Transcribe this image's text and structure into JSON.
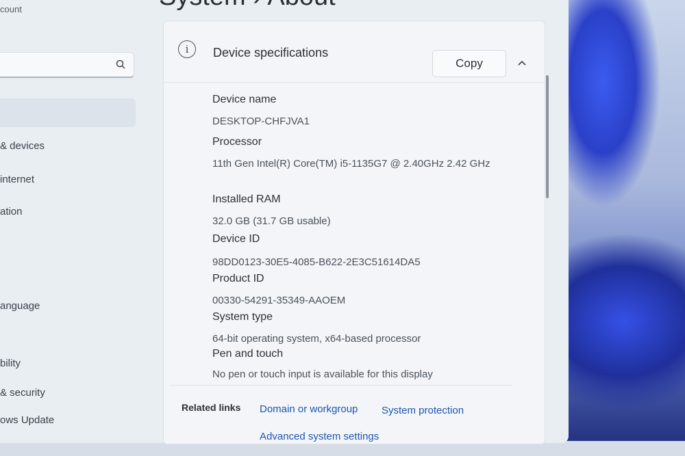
{
  "page": {
    "title": "System  ›  About"
  },
  "sidebar": {
    "account_text": "count",
    "search": {
      "placeholder": "",
      "icon": "search-icon"
    },
    "items": [
      {
        "label": "& devices"
      },
      {
        "label": "internet"
      },
      {
        "label": "ation"
      },
      {
        "label": "anguage"
      },
      {
        "label": "bility"
      },
      {
        "label": "& security"
      },
      {
        "label": "ows Update"
      }
    ]
  },
  "device_specs": {
    "title": "Device specifications",
    "icon": "info-icon",
    "copy_label": "Copy",
    "collapse_icon": "chevron-up-icon",
    "specs": [
      {
        "label": "Device name",
        "value": "DESKTOP-CHFJVA1"
      },
      {
        "label": "Processor",
        "value": "11th Gen Intel(R) Core(TM) i5-1135G7 @ 2.40GHz   2.42 GHz"
      },
      {
        "label": "Installed RAM",
        "value": "32.0 GB (31.7 GB usable)"
      },
      {
        "label": "Device ID",
        "value": "98DD0123-30E5-4085-B622-2E3C51614DA5"
      },
      {
        "label": "Product ID",
        "value": "00330-54291-35349-AAOEM"
      },
      {
        "label": "System type",
        "value": "64-bit operating system, x64-based processor"
      },
      {
        "label": "Pen and touch",
        "value": "No pen or touch input is available for this display"
      }
    ]
  },
  "related_links": {
    "title": "Related links",
    "links": [
      {
        "label": "Domain or workgroup"
      },
      {
        "label": "System protection"
      },
      {
        "label": "Advanced system settings"
      }
    ]
  }
}
